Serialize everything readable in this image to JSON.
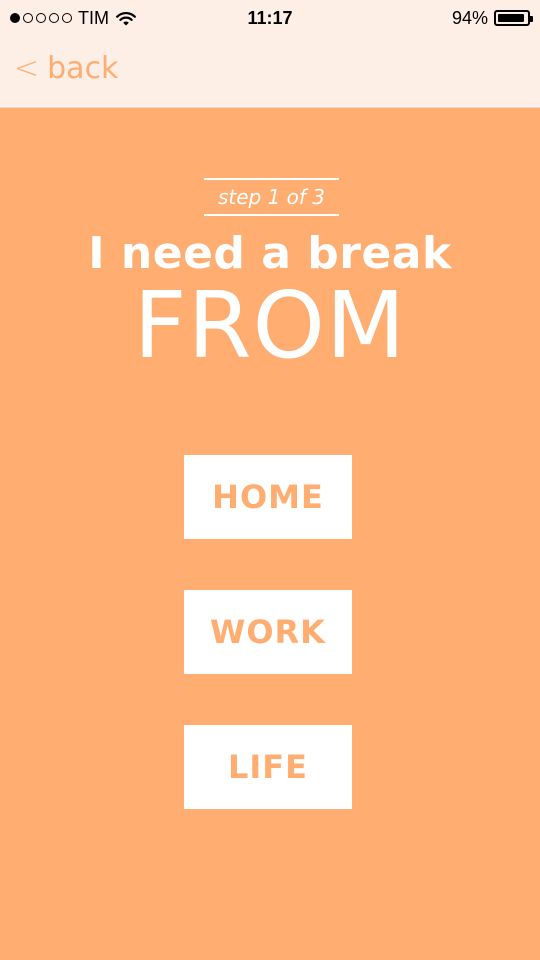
{
  "status_bar": {
    "carrier": "TIM",
    "time": "11:17",
    "battery_percent_text": "94%",
    "battery_level": 0.94,
    "signal_strength_dots": 1,
    "signal_dots_total": 5
  },
  "nav": {
    "back_label": "back",
    "back_chevron": "<"
  },
  "content": {
    "step_label": "step 1 of 3",
    "title_line_1": "I need a break",
    "title_line_2": "FROM",
    "choices": [
      {
        "label": "HOME"
      },
      {
        "label": "WORK"
      },
      {
        "label": "LIFE"
      }
    ]
  },
  "colors": {
    "accent": "#FFAD70",
    "top_bar": "#FDEFE6",
    "button_bg": "#FFFFFF",
    "text_on_accent": "#FFFFFF"
  },
  "icons": {
    "wifi": "wifi-icon",
    "battery": "battery-icon",
    "signal": "signal-dots-icon",
    "back": "chevron-left-icon"
  }
}
